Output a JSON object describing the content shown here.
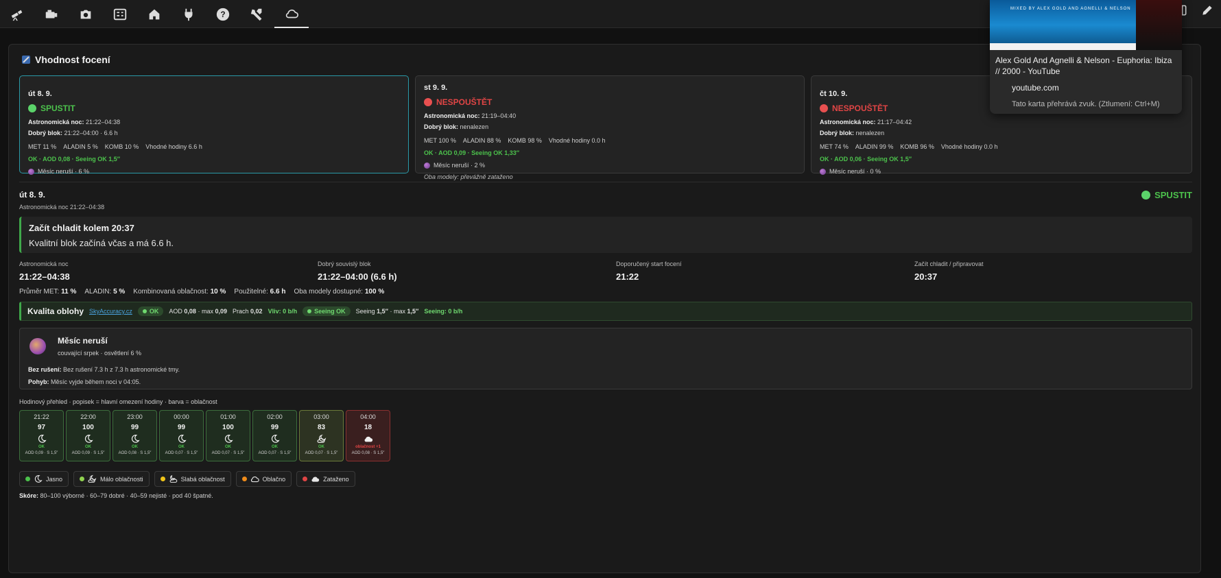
{
  "nav": {
    "tabs": [
      {
        "icon": "telescope-icon"
      },
      {
        "icon": "mount-icon"
      },
      {
        "icon": "camera-icon"
      },
      {
        "icon": "equipment-icon"
      },
      {
        "icon": "observatory-icon"
      },
      {
        "icon": "plug-icon"
      },
      {
        "icon": "question-icon"
      },
      {
        "icon": "tools-icon"
      },
      {
        "icon": "cloud-icon",
        "active": true
      }
    ],
    "right_icons": [
      "window-icon",
      "pencil-icon"
    ]
  },
  "panel": {
    "title": "Vhodnost focení"
  },
  "days": [
    {
      "name": "út 8. 9.",
      "status": "SPUSTIT",
      "status_kind": "go",
      "astro_label": "Astronomická noc:",
      "astro_value": "21:22–04:38",
      "block_label": "Dobrý blok:",
      "block_value": "21:22–04:00 · 6.6 h",
      "met": "MET 11 %",
      "aladin": "ALADIN 5 %",
      "komb": "KOMB 10 %",
      "hours": "Vhodné hodiny 6.6 h",
      "ok": "OK · AOD 0,08 · Seeing OK 1,5″",
      "moon": "Měsíc neruší · 6 %",
      "note": ""
    },
    {
      "name": "st 9. 9.",
      "status": "NESPOUŠTĚT",
      "status_kind": "nogo",
      "astro_label": "Astronomická noc:",
      "astro_value": "21:19–04:40",
      "block_label": "Dobrý blok:",
      "block_value": "nenalezen",
      "met": "MET 100 %",
      "aladin": "ALADIN 88 %",
      "komb": "KOMB 98 %",
      "hours": "Vhodné hodiny 0.0 h",
      "ok": "OK · AOD 0,09 · Seeing OK 1,33″",
      "moon": "Měsíc neruší · 2 %",
      "note": "Oba modely: převážně zataženo"
    },
    {
      "name": "čt 10. 9.",
      "status": "NESPOUŠTĚT",
      "status_kind": "nogo",
      "astro_label": "Astronomická noc:",
      "astro_value": "21:17–04:42",
      "block_label": "Dobrý blok:",
      "block_value": "nenalezen",
      "met": "MET 74 %",
      "aladin": "ALADIN 99 %",
      "komb": "KOMB 96 %",
      "hours": "Vhodné hodiny 0.0 h",
      "ok": "OK · AOD 0,06 · Seeing OK 1,5″",
      "moon": "Měsíc neruší · 0 %",
      "note": ""
    }
  ],
  "detail": {
    "day": "út 8. 9.",
    "sub": "Astronomická noc 21:22–04:38",
    "status": "SPUSTIT",
    "cool_title": "Začít chladit kolem 20:37",
    "cool_text": "Kvalitní blok začíná včas a má 6.6 h.",
    "stats": [
      {
        "label": "Astronomická noc",
        "value": "21:22–04:38"
      },
      {
        "label": "Dobrý souvislý blok",
        "value": "21:22–04:00 (6.6 h)"
      },
      {
        "label": "Doporučený start focení",
        "value": "21:22"
      },
      {
        "label": "Začít chladit / připravovat",
        "value": "20:37"
      }
    ],
    "summary": {
      "met_label": "Průměr MET:",
      "met": "11 %",
      "aladin_label": "ALADIN:",
      "aladin": "5 %",
      "komb_label": "Kombinovaná oblačnost:",
      "komb": "10 %",
      "usable_label": "Použitelné:",
      "usable": "6.6 h",
      "both_label": "Oba modely dostupné:",
      "both": "100 %"
    },
    "sky": {
      "title": "Kvalita oblohy",
      "link": "SkyAccuracy.cz",
      "pill_ok": "OK",
      "aod_label": "AOD",
      "aod": "0,08",
      "aod_max_label": "· max",
      "aod_max": "0,09",
      "dust_label": "Prach",
      "dust": "0,02",
      "vliv": "Vliv: 0 b/h",
      "pill_seeing": "Seeing OK",
      "seeing_label": "Seeing",
      "seeing": "1,5″",
      "seeing_max_label": "· max",
      "seeing_max": "1,5″",
      "seeing_vliv": "Seeing: 0 b/h"
    },
    "moon": {
      "title": "Měsíc neruší",
      "sub": "couvající srpek · osvětlení 6 %",
      "l1_label": "Bez rušení:",
      "l1": "Bez rušení 7.3 h z 7.3 h astronomické tmy.",
      "l2_label": "Pohyb:",
      "l2": "Měsíc vyjde během noci v 04:05."
    },
    "hourly_label": "Hodinový přehled · popisek = hlavní omezení hodiny · barva = oblačnost",
    "hourly": [
      {
        "time": "21:22",
        "score": "97",
        "icon": "moon-clear-icon",
        "status": "OK",
        "foot": "AOD 0,09 · S 1,5″",
        "kind": "ok"
      },
      {
        "time": "22:00",
        "score": "100",
        "icon": "moon-clear-icon",
        "status": "OK",
        "foot": "AOD 0,09 · S 1,5″",
        "kind": "ok"
      },
      {
        "time": "23:00",
        "score": "99",
        "icon": "moon-clear-icon",
        "status": "OK",
        "foot": "AOD 0,08 · S 1,5″",
        "kind": "ok"
      },
      {
        "time": "00:00",
        "score": "99",
        "icon": "moon-clear-icon",
        "status": "OK",
        "foot": "AOD 0,07 · S 1,5″",
        "kind": "ok"
      },
      {
        "time": "01:00",
        "score": "100",
        "icon": "moon-clear-icon",
        "status": "OK",
        "foot": "AOD 0,07 · S 1,5″",
        "kind": "ok"
      },
      {
        "time": "02:00",
        "score": "99",
        "icon": "moon-clear-icon",
        "status": "OK",
        "foot": "AOD 0,07 · S 1,5″",
        "kind": "ok"
      },
      {
        "time": "03:00",
        "score": "83",
        "icon": "moon-cloud-icon",
        "status": "OK",
        "foot": "AOD 0,07 · S 1,5″",
        "kind": "warn"
      },
      {
        "time": "04:00",
        "score": "18",
        "icon": "cloud-icon",
        "status": "oblačnost +1",
        "foot": "AOD 0,08 · S 1,5″",
        "kind": "bad"
      }
    ],
    "legend": [
      {
        "label": "Jasno",
        "color": "#4cc24c",
        "icon": "moon-clear-icon"
      },
      {
        "label": "Málo oblačnosti",
        "color": "#8fd14f",
        "icon": "moon-cloud-icon"
      },
      {
        "label": "Slabá oblačnost",
        "color": "#f0c419",
        "icon": "moon-clouds-icon"
      },
      {
        "label": "Oblačno",
        "color": "#f08c1a",
        "icon": "cloud-outline-icon"
      },
      {
        "label": "Zataženo",
        "color": "#e04545",
        "icon": "cloud-filled-icon"
      }
    ],
    "score_label": "Skóre:",
    "score_text": "80–100 výborné · 60–79 dobré · 40–59 nejisté · pod 40 špatné."
  },
  "tab_preview": {
    "thumb_caption": "MIXED BY ALEX GOLD AND AGNELLI & NELSON",
    "title": "Alex Gold And Agnelli & Nelson - Euphoria: Ibiza // 2000 - YouTube",
    "domain": "youtube.com",
    "audio": "Tato karta přehrává zvuk. (Ztlumení: Ctrl+M)"
  }
}
